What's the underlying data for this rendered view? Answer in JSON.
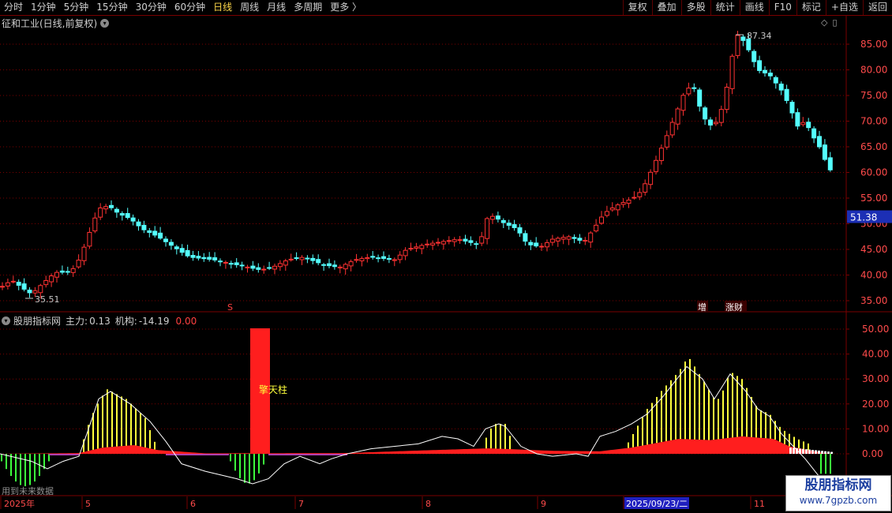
{
  "toolbar": {
    "periods": [
      "分时",
      "1分钟",
      "5分钟",
      "15分钟",
      "30分钟",
      "60分钟",
      "日线",
      "周线",
      "月线",
      "多周期",
      "更多 〉"
    ],
    "active_index": 6,
    "buttons": [
      "复权",
      "叠加",
      "多股",
      "统计",
      "画线",
      "F10",
      "标记",
      "+自选",
      "返回"
    ]
  },
  "main_chart": {
    "title": "征和工业(日线,前复权)",
    "y_ticks": [
      "85.00",
      "80.00",
      "75.00",
      "70.00",
      "65.00",
      "60.00",
      "55.00",
      "50.00",
      "45.00",
      "40.00",
      "35.00"
    ],
    "current_price": "51.38",
    "high_label": "87.34",
    "low_label": "35.51",
    "markers": {
      "s": "S",
      "zeng": "增",
      "zhangcai": "涨财"
    }
  },
  "sub_chart": {
    "name": "股朋指标网",
    "zhuli_label": "主力:",
    "zhuli_value": "0.13",
    "jigou_label": "机构:",
    "jigou_value": "-14.19",
    "extra_value": "0.00",
    "y_ticks": [
      "50.00",
      "40.00",
      "30.00",
      "20.00",
      "10.00",
      "0.00"
    ],
    "pillar_label": "擎天柱"
  },
  "x_axis": {
    "labels": [
      "2025年",
      "5",
      "6",
      "7",
      "8",
      "9",
      "2025/09/23/二",
      "11"
    ]
  },
  "hint": "用到未来数据",
  "watermark": {
    "line1": "股朋指标网",
    "line2": "www.7gpzb.com"
  },
  "colors": {
    "up": "#ff3232",
    "down": "#54ffff",
    "grid": "#7a0000",
    "text_red": "#ff4b4b",
    "yellow": "#ffff3c",
    "green": "#3cff3c"
  }
}
